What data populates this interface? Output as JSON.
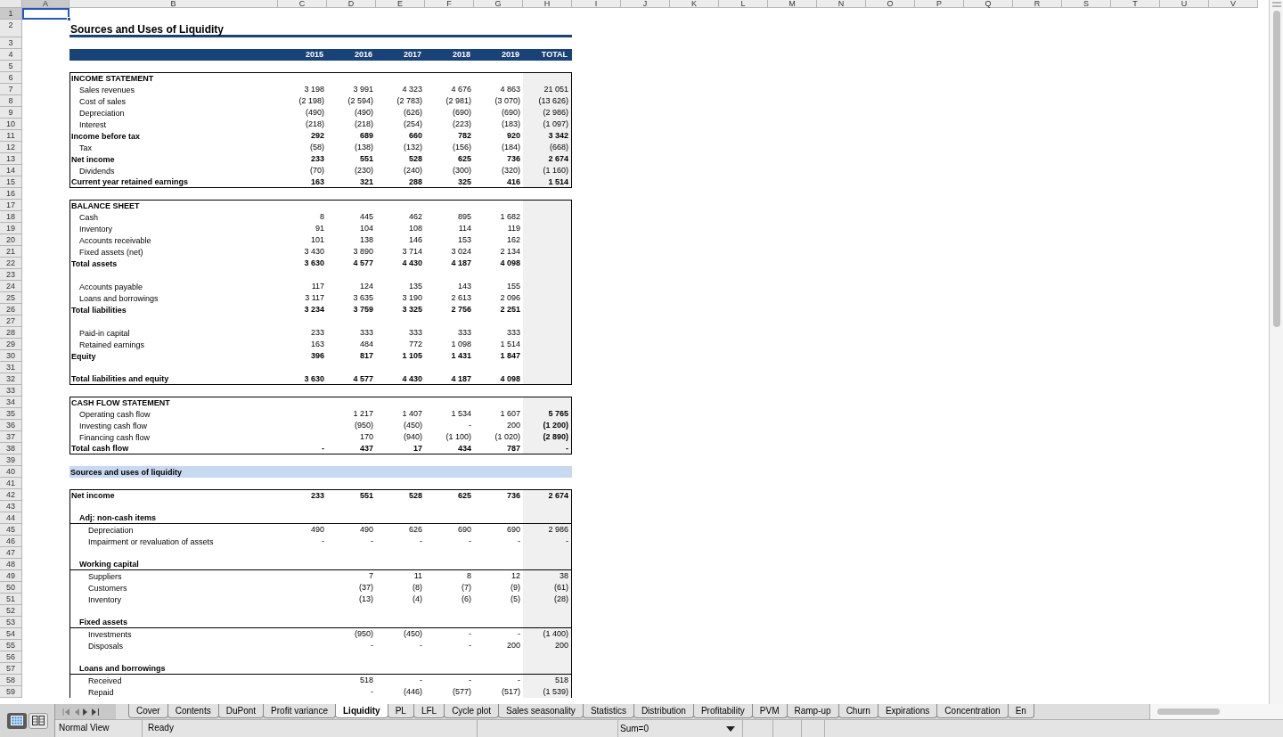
{
  "column_headers": [
    {
      "label": "A",
      "selected": true
    },
    {
      "label": "B",
      "selected": false
    },
    {
      "label": "C",
      "selected": false
    },
    {
      "label": "D",
      "selected": false
    },
    {
      "label": "E",
      "selected": false
    },
    {
      "label": "F",
      "selected": false
    },
    {
      "label": "G",
      "selected": false
    },
    {
      "label": "H",
      "selected": false
    },
    {
      "label": "I",
      "selected": false
    },
    {
      "label": "J",
      "selected": false
    },
    {
      "label": "K",
      "selected": false
    },
    {
      "label": "L",
      "selected": false
    },
    {
      "label": "M",
      "selected": false
    },
    {
      "label": "N",
      "selected": false
    },
    {
      "label": "O",
      "selected": false
    },
    {
      "label": "P",
      "selected": false
    },
    {
      "label": "Q",
      "selected": false
    },
    {
      "label": "R",
      "selected": false
    },
    {
      "label": "S",
      "selected": false
    },
    {
      "label": "T",
      "selected": false
    },
    {
      "label": "U",
      "selected": false
    },
    {
      "label": "V",
      "selected": false
    }
  ],
  "rows": [
    {
      "n": "1",
      "selected": true,
      "boxed": false
    },
    {
      "n": "2",
      "selected": false,
      "boxed": false,
      "kind": "title",
      "label": "Sources and Uses of Liquidity"
    },
    {
      "n": "3",
      "selected": false,
      "boxed": false
    },
    {
      "n": "4",
      "selected": false,
      "boxed": false,
      "kind": "header",
      "cells": {
        "C": "2015",
        "D": "2016",
        "E": "2017",
        "F": "2018",
        "G": "2019",
        "H": "TOTAL"
      }
    },
    {
      "n": "5",
      "selected": false,
      "boxed": false
    },
    {
      "n": "6",
      "selected": false,
      "boxed": true,
      "kind": "section",
      "label": "INCOME STATEMENT"
    },
    {
      "n": "7",
      "selected": false,
      "boxed": true,
      "kind": "item",
      "label": "Sales revenues",
      "cells": {
        "C": "3 198",
        "D": "3 991",
        "E": "4 323",
        "F": "4 676",
        "G": "4 863",
        "H": "21 051"
      }
    },
    {
      "n": "8",
      "selected": false,
      "boxed": true,
      "kind": "item",
      "label": "Cost of sales",
      "cells": {
        "C": "(2 198)",
        "D": "(2 594)",
        "E": "(2 783)",
        "F": "(2 981)",
        "G": "(3 070)",
        "H": "(13 626)"
      }
    },
    {
      "n": "9",
      "selected": false,
      "boxed": true,
      "kind": "item",
      "label": "Depreciation",
      "cells": {
        "C": "(490)",
        "D": "(490)",
        "E": "(626)",
        "F": "(690)",
        "G": "(690)",
        "H": "(2 986)"
      }
    },
    {
      "n": "10",
      "selected": false,
      "boxed": true,
      "kind": "item",
      "label": "Interest",
      "cells": {
        "C": "(218)",
        "D": "(218)",
        "E": "(254)",
        "F": "(223)",
        "G": "(183)",
        "H": "(1 097)"
      }
    },
    {
      "n": "11",
      "selected": false,
      "boxed": true,
      "kind": "total",
      "label": "Income before tax",
      "cells": {
        "C": "292",
        "D": "689",
        "E": "660",
        "F": "782",
        "G": "920",
        "H": "3 342"
      }
    },
    {
      "n": "12",
      "selected": false,
      "boxed": true,
      "kind": "item",
      "label": "Tax",
      "cells": {
        "C": "(58)",
        "D": "(138)",
        "E": "(132)",
        "F": "(156)",
        "G": "(184)",
        "H": "(668)"
      }
    },
    {
      "n": "13",
      "selected": false,
      "boxed": true,
      "kind": "total",
      "label": "Net income",
      "cells": {
        "C": "233",
        "D": "551",
        "E": "528",
        "F": "625",
        "G": "736",
        "H": "2 674"
      }
    },
    {
      "n": "14",
      "selected": false,
      "boxed": true,
      "kind": "item",
      "label": "Dividends",
      "cells": {
        "C": "(70)",
        "D": "(230)",
        "E": "(240)",
        "F": "(300)",
        "G": "(320)",
        "H": "(1 160)"
      }
    },
    {
      "n": "15",
      "selected": false,
      "boxed": true,
      "kind": "total",
      "label": "Current year retained earnings",
      "cells": {
        "C": "163",
        "D": "321",
        "E": "288",
        "F": "325",
        "G": "416",
        "H": "1 514"
      }
    },
    {
      "n": "16",
      "selected": false,
      "boxed": false
    },
    {
      "n": "17",
      "selected": false,
      "boxed": true,
      "kind": "section",
      "label": "BALANCE SHEET"
    },
    {
      "n": "18",
      "selected": false,
      "boxed": true,
      "kind": "item",
      "label": "Cash",
      "cells": {
        "C": "8",
        "D": "445",
        "E": "462",
        "F": "895",
        "G": "1 682"
      }
    },
    {
      "n": "19",
      "selected": false,
      "boxed": true,
      "kind": "item",
      "label": "Inventory",
      "cells": {
        "C": "91",
        "D": "104",
        "E": "108",
        "F": "114",
        "G": "119"
      }
    },
    {
      "n": "20",
      "selected": false,
      "boxed": true,
      "kind": "item",
      "label": "Accounts receivable",
      "cells": {
        "C": "101",
        "D": "138",
        "E": "146",
        "F": "153",
        "G": "162"
      }
    },
    {
      "n": "21",
      "selected": false,
      "boxed": true,
      "kind": "item",
      "label": "Fixed assets (net)",
      "cells": {
        "C": "3 430",
        "D": "3 890",
        "E": "3 714",
        "F": "3 024",
        "G": "2 134"
      }
    },
    {
      "n": "22",
      "selected": false,
      "boxed": true,
      "kind": "total",
      "label": "Total assets",
      "cells": {
        "C": "3 630",
        "D": "4 577",
        "E": "4 430",
        "F": "4 187",
        "G": "4 098"
      }
    },
    {
      "n": "23",
      "selected": false
    },
    {
      "n": "24",
      "selected": false,
      "boxed": true,
      "kind": "item",
      "label": "Accounts payable",
      "cells": {
        "C": "117",
        "D": "124",
        "E": "135",
        "F": "143",
        "G": "155"
      }
    },
    {
      "n": "25",
      "selected": false,
      "boxed": true,
      "kind": "item",
      "label": "Loans and borrowings",
      "cells": {
        "C": "3 117",
        "D": "3 635",
        "E": "3 190",
        "F": "2 613",
        "G": "2 096"
      }
    },
    {
      "n": "26",
      "selected": false,
      "boxed": true,
      "kind": "total",
      "label": "Total liabilities",
      "cells": {
        "C": "3 234",
        "D": "3 759",
        "E": "3 325",
        "F": "2 756",
        "G": "2 251"
      }
    },
    {
      "n": "27",
      "selected": false
    },
    {
      "n": "28",
      "selected": false,
      "boxed": true,
      "kind": "item",
      "label": "Paid-in capital",
      "cells": {
        "C": "233",
        "D": "333",
        "E": "333",
        "F": "333",
        "G": "333"
      }
    },
    {
      "n": "29",
      "selected": false,
      "boxed": true,
      "kind": "item",
      "label": "Retained earnings",
      "cells": {
        "C": "163",
        "D": "484",
        "E": "772",
        "F": "1 098",
        "G": "1 514"
      }
    },
    {
      "n": "30",
      "selected": false,
      "boxed": true,
      "kind": "total",
      "label": "Equity",
      "cells": {
        "C": "396",
        "D": "817",
        "E": "1 105",
        "F": "1 431",
        "G": "1 847"
      }
    },
    {
      "n": "31",
      "selected": false
    },
    {
      "n": "32",
      "selected": false,
      "boxed": true,
      "kind": "total",
      "label": "Total liabilities and equity",
      "cells": {
        "C": "3 630",
        "D": "4 577",
        "E": "4 430",
        "F": "4 187",
        "G": "4 098"
      }
    },
    {
      "n": "33",
      "selected": false,
      "boxed": false
    },
    {
      "n": "34",
      "selected": false,
      "boxed": true,
      "kind": "section",
      "label": "CASH FLOW STATEMENT"
    },
    {
      "n": "35",
      "selected": false,
      "boxed": true,
      "kind": "cashflow_item",
      "label": "Operating cash flow",
      "cells": {
        "D": "1 217",
        "E": "1 407",
        "F": "1 534",
        "G": "1 607",
        "H": "5 765"
      }
    },
    {
      "n": "36",
      "selected": false,
      "boxed": true,
      "kind": "cashflow_item",
      "label": "Investing cash flow",
      "cells": {
        "D": "(950)",
        "E": "(450)",
        "F": "-",
        "G": "200",
        "H": "(1 200)"
      }
    },
    {
      "n": "37",
      "selected": false,
      "boxed": true,
      "kind": "cashflow_item",
      "label": "Financing cash flow",
      "cells": {
        "D": "170",
        "E": "(940)",
        "F": "(1 100)",
        "G": "(1 020)",
        "H": "(2 890)"
      }
    },
    {
      "n": "38",
      "selected": false,
      "boxed": true,
      "kind": "total",
      "label": "Total cash flow",
      "cells": {
        "C": "-",
        "D": "437",
        "E": "17",
        "F": "434",
        "G": "787",
        "H": "-"
      }
    },
    {
      "n": "39",
      "selected": false,
      "boxed": false
    },
    {
      "n": "40",
      "selected": false,
      "boxed": false,
      "kind": "band",
      "label": "Sources and uses of liquidity"
    },
    {
      "n": "41",
      "selected": false,
      "boxed": false
    },
    {
      "n": "42",
      "selected": false,
      "boxed": true,
      "kind": "total",
      "label": "Net income",
      "cells": {
        "C": "233",
        "D": "551",
        "E": "528",
        "F": "625",
        "G": "736",
        "H": "2 674"
      }
    },
    {
      "n": "43",
      "selected": false
    },
    {
      "n": "44",
      "selected": false,
      "boxed": true,
      "kind": "subhead",
      "label": "Adj: non-cash items"
    },
    {
      "n": "45",
      "selected": false,
      "boxed": true,
      "kind": "subitem",
      "label": "Depreciation",
      "cells": {
        "C": "490",
        "D": "490",
        "E": "626",
        "F": "690",
        "G": "690",
        "H": "2 986"
      }
    },
    {
      "n": "46",
      "selected": false,
      "boxed": true,
      "kind": "subitem",
      "label": "Impairment or revaluation of assets",
      "cells": {
        "C": "-",
        "D": "-",
        "E": "-",
        "F": "-",
        "G": "-",
        "H": "-"
      }
    },
    {
      "n": "47",
      "selected": false
    },
    {
      "n": "48",
      "selected": false,
      "boxed": true,
      "kind": "subhead",
      "label": "Working capital"
    },
    {
      "n": "49",
      "selected": false,
      "boxed": true,
      "kind": "subitem",
      "label": "Suppliers",
      "cells": {
        "D": "7",
        "E": "11",
        "F": "8",
        "G": "12",
        "H": "38"
      }
    },
    {
      "n": "50",
      "selected": false,
      "boxed": true,
      "kind": "subitem",
      "label": "Customers",
      "cells": {
        "D": "(37)",
        "E": "(8)",
        "F": "(7)",
        "G": "(9)",
        "H": "(61)"
      }
    },
    {
      "n": "51",
      "selected": false,
      "boxed": true,
      "kind": "subitem",
      "label": "Inventory",
      "cells": {
        "D": "(13)",
        "E": "(4)",
        "F": "(6)",
        "G": "(5)",
        "H": "(28)"
      }
    },
    {
      "n": "52",
      "selected": false
    },
    {
      "n": "53",
      "selected": false,
      "boxed": true,
      "kind": "subhead",
      "label": "Fixed assets"
    },
    {
      "n": "54",
      "selected": false,
      "boxed": true,
      "kind": "subitem",
      "label": "Investments",
      "cells": {
        "D": "(950)",
        "E": "(450)",
        "F": "-",
        "G": "-",
        "H": "(1 400)"
      }
    },
    {
      "n": "55",
      "selected": false,
      "boxed": true,
      "kind": "subitem",
      "label": "Disposals",
      "cells": {
        "D": "-",
        "E": "-",
        "F": "-",
        "G": "200",
        "H": "200"
      }
    },
    {
      "n": "56",
      "selected": false
    },
    {
      "n": "57",
      "selected": false,
      "boxed": true,
      "kind": "subhead",
      "label": "Loans and borrowings"
    },
    {
      "n": "58",
      "selected": false,
      "boxed": true,
      "kind": "subitem",
      "label": "Received",
      "cells": {
        "D": "518",
        "E": "-",
        "F": "-",
        "G": "-",
        "H": "518"
      }
    },
    {
      "n": "59",
      "selected": false,
      "boxed": true,
      "kind": "subitem",
      "label": "Repaid",
      "cells": {
        "D": "-",
        "E": "(446)",
        "F": "(577)",
        "G": "(517)",
        "H": "(1 539)"
      }
    }
  ],
  "sheet_tabs": [
    {
      "label": "Cover",
      "selected": false
    },
    {
      "label": "Contents",
      "selected": false
    },
    {
      "label": "DuPont",
      "selected": false
    },
    {
      "label": "Profit variance",
      "selected": false
    },
    {
      "label": "Liquidity",
      "selected": true
    },
    {
      "label": "PL",
      "selected": false
    },
    {
      "label": "LFL",
      "selected": false
    },
    {
      "label": "Cycle plot",
      "selected": false
    },
    {
      "label": "Sales seasonality",
      "selected": false
    },
    {
      "label": "Statistics",
      "selected": false
    },
    {
      "label": "Distribution",
      "selected": false
    },
    {
      "label": "Profitability",
      "selected": false
    },
    {
      "label": "PVM",
      "selected": false
    },
    {
      "label": "Ramp-up",
      "selected": false
    },
    {
      "label": "Churn",
      "selected": false
    },
    {
      "label": "Expirations",
      "selected": false
    },
    {
      "label": "Concentration",
      "selected": false
    },
    {
      "label": "En",
      "selected": false
    }
  ],
  "status_bar": {
    "view": "Normal View",
    "mode": "Ready",
    "summary": "Sum=0"
  }
}
